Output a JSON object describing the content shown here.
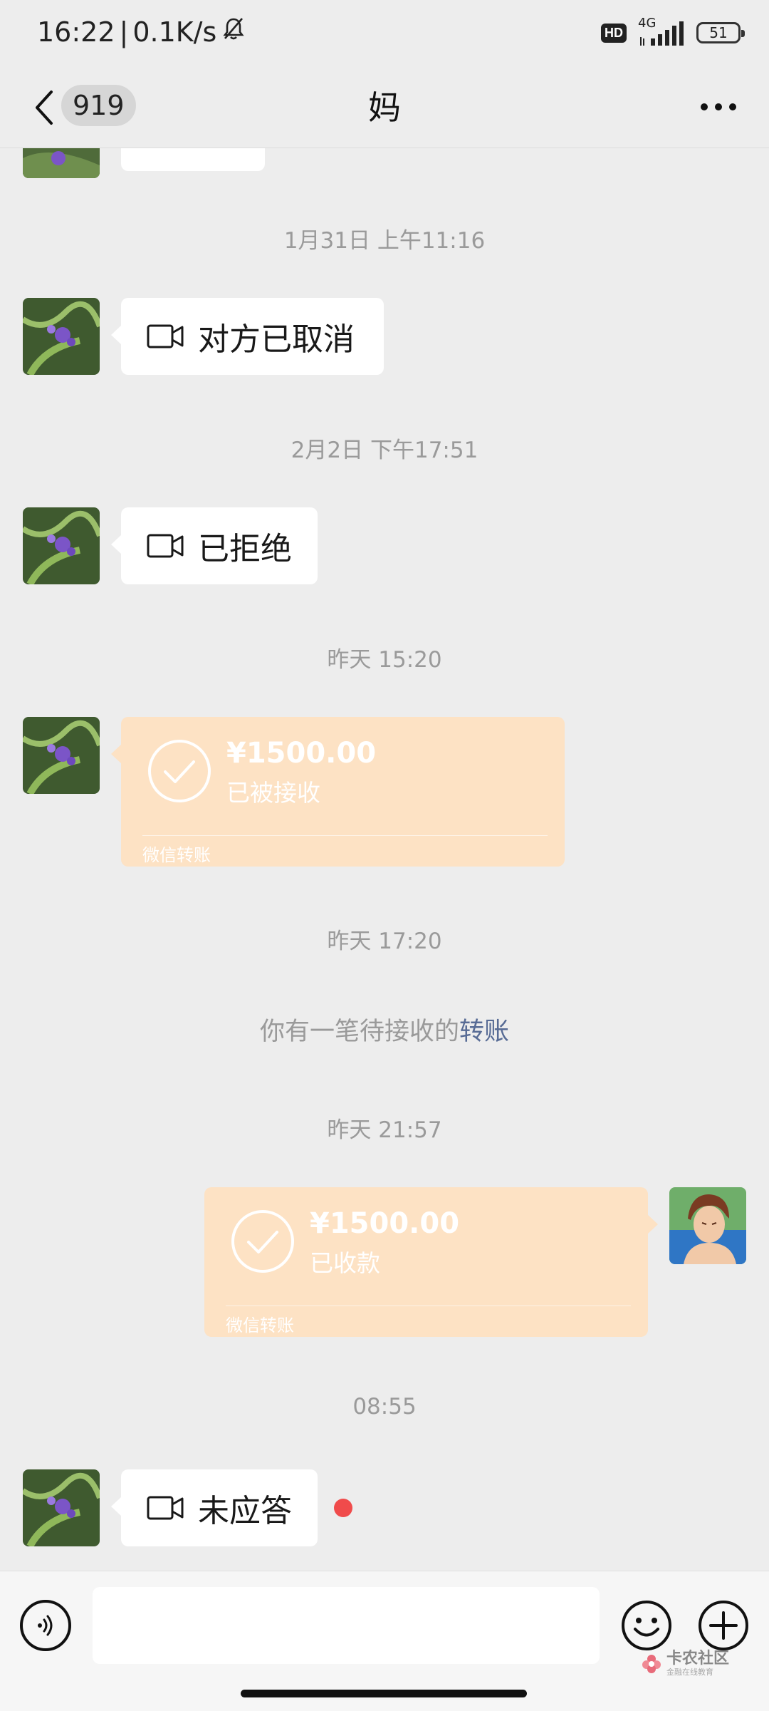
{
  "status_bar": {
    "time": "16:22",
    "separator": "|",
    "net_speed": "0.1K/s",
    "hd_label": "HD",
    "network_label": "4G",
    "battery": "51",
    "icons": [
      "bell-muted-icon",
      "signal-icon",
      "battery-icon"
    ]
  },
  "nav": {
    "unread_count": "919",
    "title": "妈",
    "icons": [
      "back-arrow-icon",
      "more-icon"
    ]
  },
  "messages": {
    "ts1": "1月31日 上午11:16",
    "call1": "对方已取消",
    "ts2": "2月2日 下午17:51",
    "call2": "已拒绝",
    "ts3": "昨天 15:20",
    "transfer1": {
      "amount": "¥1500.00",
      "status": "已被接收",
      "brand": "微信转账"
    },
    "ts4": "昨天 17:20",
    "system_note": {
      "prefix": "你有一笔待接收的",
      "link": "转账"
    },
    "ts5": "昨天 21:57",
    "transfer2": {
      "amount": "¥1500.00",
      "status": "已收款",
      "brand": "微信转账"
    },
    "ts6": "08:55",
    "call3": "未应答"
  },
  "input": {
    "placeholder": "",
    "icons": [
      "voice-icon",
      "emoji-icon",
      "plus-icon"
    ]
  },
  "watermark": {
    "title": "卡农社区",
    "subtitle": "金融在线教育"
  },
  "colors": {
    "background": "#ededed",
    "bubble_white": "#ffffff",
    "transfer_bg": "#fde2c4",
    "link": "#576b95",
    "unread_dot": "#f04b4b"
  }
}
